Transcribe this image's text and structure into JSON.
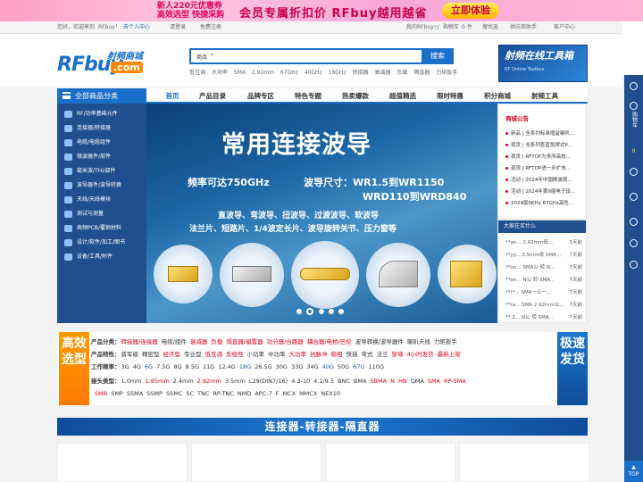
{
  "banner": {
    "line1": "新人220元优惠券",
    "line2": "高效选型 快捷采购",
    "slogan": "会员专属折扣价 RFbuy越用越省",
    "cta": "立即体验"
  },
  "topbar": {
    "welcome": "您好，欢迎来到",
    "site": "RFbuy！",
    "member_center": "去个人中心",
    "login": "请登录",
    "register": "免费注册",
    "my_rfbuy": "我的RFbuy",
    "cart": "购物车",
    "cart_count": "0",
    "cart_unit": "件",
    "quick_order": "搜优选",
    "supplier": "供应商助手",
    "service": "客户中心"
  },
  "logo": {
    "rf": "RFbuy",
    "com": ".com",
    "cn": "射频商城"
  },
  "search": {
    "category": "商品",
    "placeholder": "",
    "button": "搜索"
  },
  "hotwords": [
    "低互调",
    "大功率",
    "SMA",
    "2.92mm",
    "67GHz",
    "40GHz",
    "18GHz",
    "转接器",
    "衰减器",
    "负载",
    "隔直器",
    "力矩扳手"
  ],
  "toolbox": {
    "title": "射频在线工具箱",
    "sub": "RF Online Toolbox"
  },
  "category_button": "全部商品分类",
  "nav": [
    "首页",
    "产品目录",
    "品牌专区",
    "特色专题",
    "热卖爆款",
    "超值精选",
    "限时特惠",
    "积分商城",
    "射频工具"
  ],
  "sidebar": [
    "RF/功率基础元件",
    "连接器/转接器",
    "电缆/电缆组件",
    "微波器件/部件",
    "毫米波/THz部件",
    "波导器件/波导转换",
    "天线/天线模块",
    "测试与测量",
    "高频PCB/覆铜材料",
    "设计/软件/加工/图书",
    "设备/工具/附件"
  ],
  "hero": {
    "title": "常用连接波导",
    "freq": "频率可达750GHz",
    "size1": "波导尺寸：WR1.5到WR1150",
    "size2": "WRD110到WRD840",
    "types1": "直波导、弯波导、扭波导、过渡波导、软波导",
    "types2": "法兰片、短路片、1/4波定长片、波导旋转关节、压力窗等"
  },
  "notice": {
    "title": "商城公告",
    "items": [
      "新品 | 全系列标准增益喇叭...",
      "现货 | 全系列查直免焊式P...",
      "现货 | RFTOP为多所高校...",
      "现货 | RFTOP进一步扩充...",
      "活动 | 2024年中国微波周...",
      "活动 | 2024年第9届电子设...",
      "2024版9KHz-67GHz高性..."
    ]
  },
  "buying": {
    "title": "大家在买什么",
    "items": [
      {
        "text": "**an... 2.92mm母...",
        "time": "5天前"
      },
      {
        "text": "**yy... 3.5mm母 SMA...",
        "time": "7天前"
      },
      {
        "text": "**on... SMA公 转 N...",
        "time": "7天前"
      },
      {
        "text": "**on... N公 转 SMA...",
        "time": "7天前"
      },
      {
        "text": "**!*... SMA一公一...",
        "time": "7天前"
      },
      {
        "text": "**ra... SMA 2.92mm公...",
        "time": "7天前"
      },
      {
        "text": "**.Z... N公 转 SMA...",
        "time": "7天前"
      }
    ]
  },
  "filter": {
    "badge_left": "高效选型",
    "badge_right": "极速发货",
    "rows": [
      {
        "label": "产品分类：",
        "items": [
          {
            "t": "转接器/连接器",
            "c": "r"
          },
          {
            "t": "电缆/组件",
            "c": ""
          },
          {
            "t": "衰减器",
            "c": "r"
          },
          {
            "t": "负载",
            "c": "r"
          },
          {
            "t": "隔直器/偏置器",
            "c": "r"
          },
          {
            "t": "功分器/合路器",
            "c": "r"
          },
          {
            "t": "耦合器/电桥/巴伦",
            "c": "r"
          },
          {
            "t": "波导转换/波导器件",
            "c": ""
          },
          {
            "t": "喇叭天线",
            "c": ""
          },
          {
            "t": "力矩扳手",
            "c": ""
          }
        ]
      },
      {
        "label": "产品特性：",
        "items": [
          {
            "t": "普军级",
            "c": ""
          },
          {
            "t": "精密型",
            "c": ""
          },
          {
            "t": "经济型",
            "c": "r"
          },
          {
            "t": "专业型",
            "c": ""
          },
          {
            "t": "低互调",
            "c": "r"
          },
          {
            "t": "反极性",
            "c": "r"
          },
          {
            "t": "小功率",
            "c": ""
          },
          {
            "t": "中功率",
            "c": ""
          },
          {
            "t": "大功率",
            "c": "r"
          },
          {
            "t": "抗脉冲",
            "c": "r"
          },
          {
            "t": "稳相",
            "c": "r"
          },
          {
            "t": "快插",
            "c": ""
          },
          {
            "t": "弯式",
            "c": ""
          },
          {
            "t": "法兰",
            "c": ""
          },
          {
            "t": "穿墙",
            "c": "r"
          },
          {
            "t": "4小时发货",
            "c": "r"
          },
          {
            "t": "最新上架",
            "c": "r"
          }
        ]
      },
      {
        "label": "工作频率：",
        "items": [
          {
            "t": "3G",
            "c": ""
          },
          {
            "t": "4G",
            "c": ""
          },
          {
            "t": "6G",
            "c": "bl"
          },
          {
            "t": "7.5G",
            "c": ""
          },
          {
            "t": "8G",
            "c": ""
          },
          {
            "t": "8.5G",
            "c": ""
          },
          {
            "t": "11G",
            "c": ""
          },
          {
            "t": "12.4G",
            "c": ""
          },
          {
            "t": "18G",
            "c": "bl"
          },
          {
            "t": "26.5G",
            "c": ""
          },
          {
            "t": "30G",
            "c": ""
          },
          {
            "t": "33G",
            "c": ""
          },
          {
            "t": "34G",
            "c": ""
          },
          {
            "t": "40G",
            "c": "bl"
          },
          {
            "t": "50G",
            "c": ""
          },
          {
            "t": "67G",
            "c": "bl"
          },
          {
            "t": "110G",
            "c": ""
          }
        ]
      },
      {
        "label": "接头类型：",
        "items": [
          {
            "t": "1.0mm",
            "c": ""
          },
          {
            "t": "1.85mm",
            "c": "r"
          },
          {
            "t": "2.4mm",
            "c": ""
          },
          {
            "t": "2.92mm",
            "c": "r"
          },
          {
            "t": "3.5mm",
            "c": ""
          },
          {
            "t": "L29(DIN7/16)",
            "c": ""
          },
          {
            "t": "4.3-10",
            "c": ""
          },
          {
            "t": "4.1/9.5",
            "c": ""
          },
          {
            "t": "BNC",
            "c": ""
          },
          {
            "t": "BMA",
            "c": ""
          },
          {
            "t": "SBMA",
            "c": "r"
          },
          {
            "t": "N",
            "c": "r"
          },
          {
            "t": "HN",
            "c": "r"
          },
          {
            "t": "QMA",
            "c": ""
          },
          {
            "t": "SMA",
            "c": "r"
          },
          {
            "t": "RP-SMA",
            "c": "r"
          }
        ]
      },
      {
        "label": "",
        "items": [
          {
            "t": "SMB",
            "c": "r"
          },
          {
            "t": "SMP",
            "c": ""
          },
          {
            "t": "SSMA",
            "c": ""
          },
          {
            "t": "SSMP",
            "c": ""
          },
          {
            "t": "SSMC",
            "c": ""
          },
          {
            "t": "SC",
            "c": ""
          },
          {
            "t": "TNC",
            "c": ""
          },
          {
            "t": "RP-TNC",
            "c": ""
          },
          {
            "t": "NMD",
            "c": ""
          },
          {
            "t": "APC-7",
            "c": ""
          },
          {
            "t": "F",
            "c": ""
          },
          {
            "t": "MCX",
            "c": ""
          },
          {
            "t": "MMCX",
            "c": ""
          },
          {
            "t": "NEX10",
            "c": ""
          }
        ]
      }
    ]
  },
  "section_title": "连接器-转接器-隔直器",
  "rightbar": [
    "购物车",
    "0",
    "收藏",
    "客服",
    "顶部"
  ],
  "rightbar_top": "TOP",
  "colors": {
    "brand": "#1a6fc9",
    "accent": "#ff8a00",
    "red": "#e0001a"
  }
}
